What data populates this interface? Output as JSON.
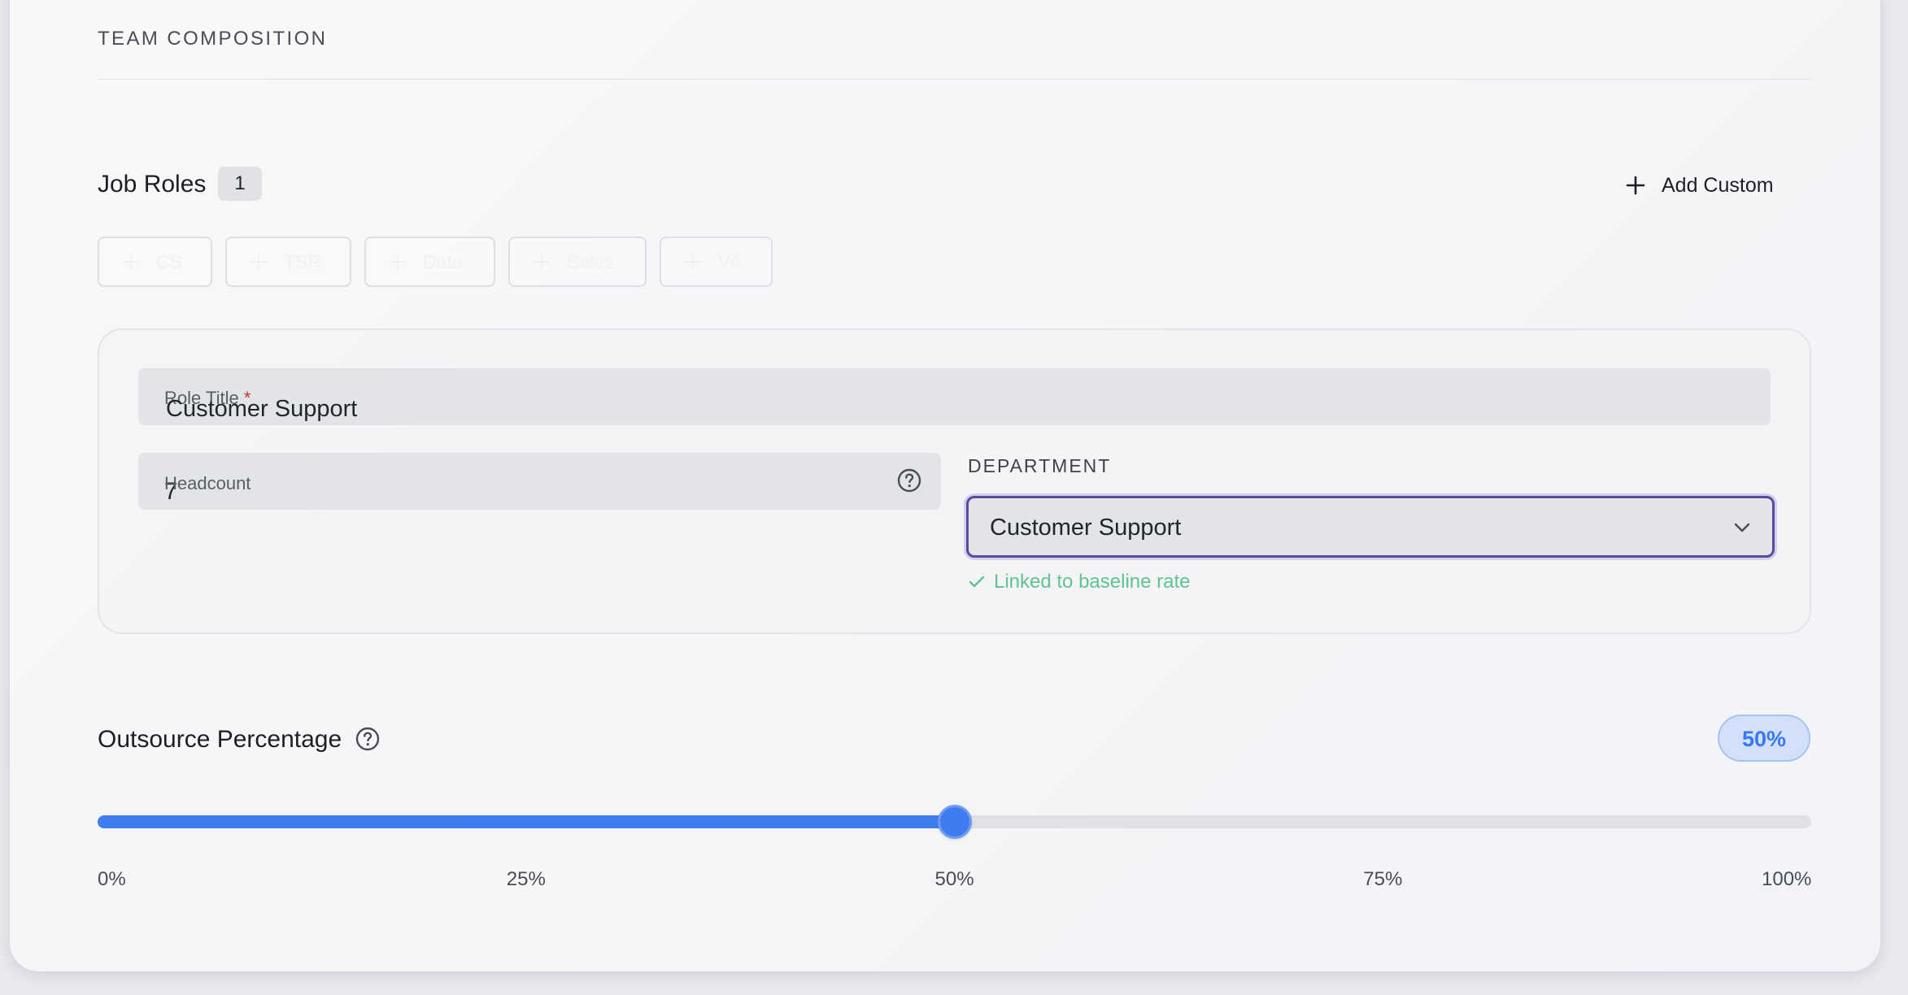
{
  "section": {
    "title": "TEAM COMPOSITION"
  },
  "roles": {
    "title": "Job Roles",
    "count": "1",
    "add_custom_label": "Add Custom",
    "presets": [
      {
        "label": "CS"
      },
      {
        "label": "TSR"
      },
      {
        "label": "Data"
      },
      {
        "label": "Sales"
      },
      {
        "label": "VA"
      }
    ]
  },
  "role_form": {
    "role_title": {
      "label": "Role Title",
      "required_mark": "*",
      "value": "Customer Support"
    },
    "headcount": {
      "label": "Headcount",
      "value": "7"
    },
    "department": {
      "label": "DEPARTMENT",
      "selected": "Customer Support",
      "note": "Linked to baseline rate"
    }
  },
  "outsource": {
    "title": "Outsource Percentage",
    "value_label": "50%",
    "value_fraction": 0.5,
    "ticks": [
      "0%",
      "25%",
      "50%",
      "75%",
      "100%"
    ]
  },
  "colors": {
    "accent": "#3e7df0",
    "focus_border": "#5b4a9c",
    "success": "#5fc393",
    "required": "#c0392b"
  },
  "icons": {
    "add": "plus-icon",
    "help": "question-circle-icon",
    "chevron": "chevron-down-icon",
    "check": "check-icon"
  }
}
